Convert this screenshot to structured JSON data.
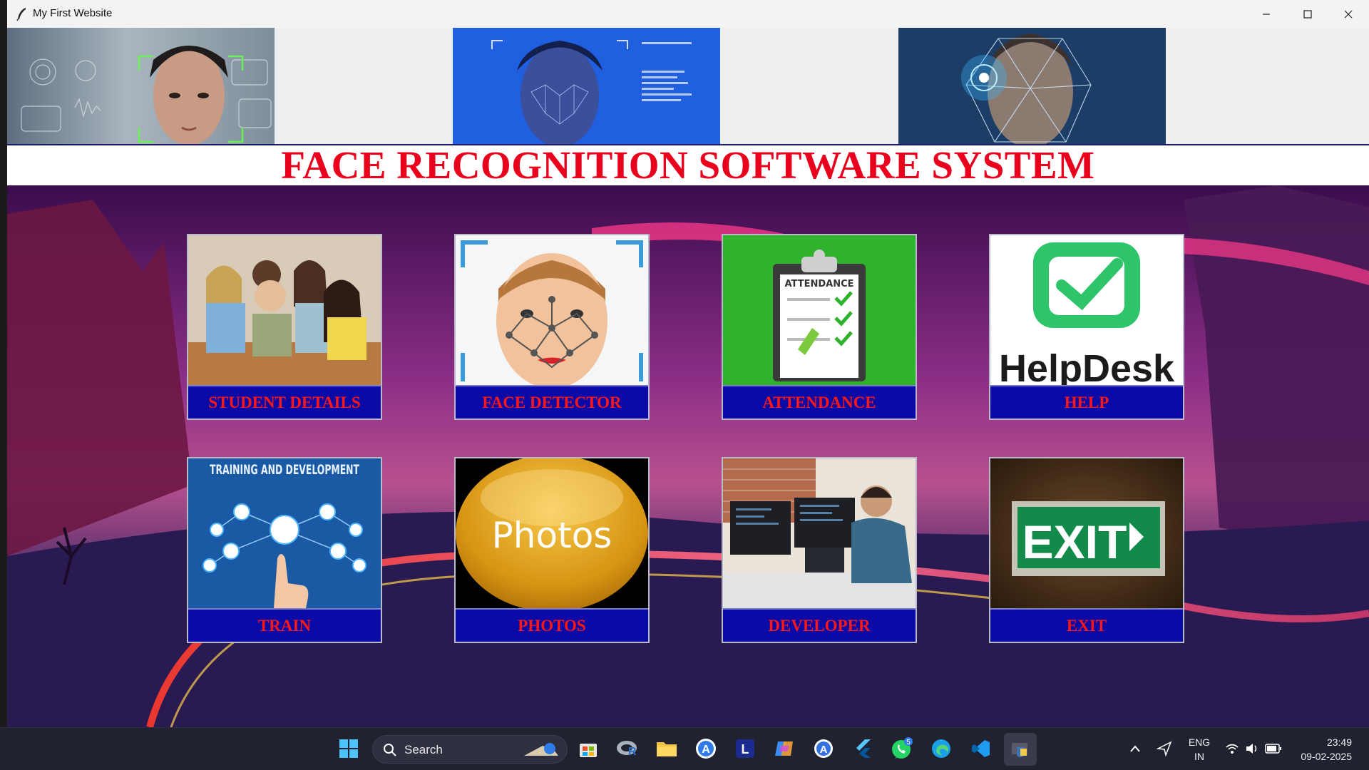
{
  "window": {
    "title": "My First Website"
  },
  "heading": {
    "title": "FACE RECOGNITION SOFTWARE SYSTEM",
    "color": "#e8001c"
  },
  "tiles": [
    {
      "label": "STUDENT DETAILS",
      "icon": "students-photo"
    },
    {
      "label": "FACE DETECTOR",
      "icon": "face-mesh-illustration"
    },
    {
      "label": "ATTENDANCE",
      "icon": "attendance-clipboard",
      "image_text": "ATTENDANCE"
    },
    {
      "label": "HELP",
      "icon": "helpdesk-logo",
      "image_text": "HelpDesk"
    },
    {
      "label": "TRAIN",
      "icon": "training-network",
      "image_text": "TRAINING AND DEVELOPMENT"
    },
    {
      "label": "PHOTOS",
      "icon": "photos-button",
      "image_text": "Photos"
    },
    {
      "label": "DEVELOPER",
      "icon": "developer-photo"
    },
    {
      "label": "EXIT",
      "icon": "exit-sign",
      "image_text": "EXIT"
    }
  ],
  "taskbar": {
    "search_label": "Search",
    "language": "ENG",
    "region": "IN",
    "time": "23:49",
    "date": "09-02-2025",
    "whatsapp_badge": "5"
  }
}
